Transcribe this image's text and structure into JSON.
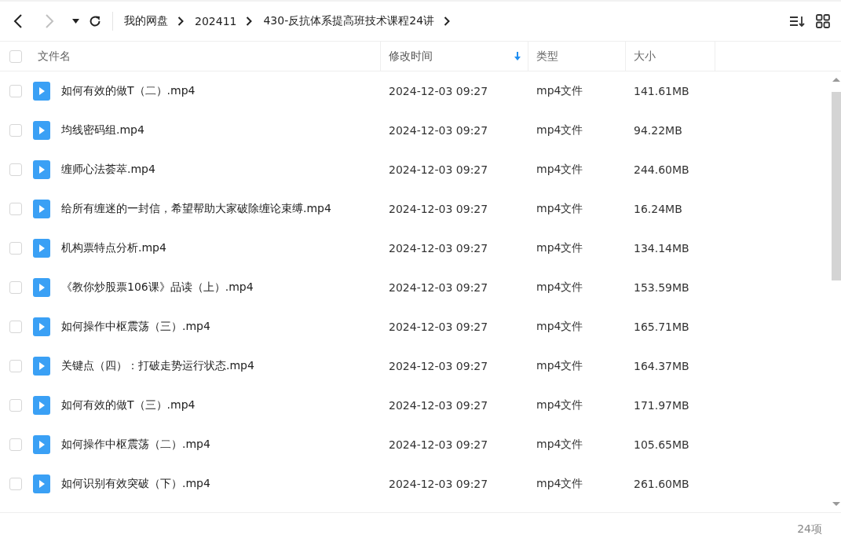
{
  "toolbar": {
    "back": {
      "disabled": false
    },
    "forward": {
      "disabled": true
    },
    "breadcrumbs": [
      "我的网盘",
      "202411",
      "430-反抗体系提高班技术课程24讲"
    ]
  },
  "table": {
    "columns": [
      {
        "label": "文件名",
        "sorted": false
      },
      {
        "label": "修改时间",
        "sorted": true
      },
      {
        "label": "类型",
        "sorted": false
      },
      {
        "label": "大小",
        "sorted": false
      }
    ],
    "all_checked": false,
    "rows": [
      {
        "name": "如何有效的做T（二）.mp4",
        "modified": "2024-12-03 09:27",
        "type": "mp4文件",
        "size": "141.61MB",
        "checked": false
      },
      {
        "name": "均线密码组.mp4",
        "modified": "2024-12-03 09:27",
        "type": "mp4文件",
        "size": "94.22MB",
        "checked": false
      },
      {
        "name": "缠师心法荟萃.mp4",
        "modified": "2024-12-03 09:27",
        "type": "mp4文件",
        "size": "244.60MB",
        "checked": false
      },
      {
        "name": "给所有缠迷的一封信，希望帮助大家破除缠论束缚.mp4",
        "modified": "2024-12-03 09:27",
        "type": "mp4文件",
        "size": "16.24MB",
        "checked": false
      },
      {
        "name": "机构票特点分析.mp4",
        "modified": "2024-12-03 09:27",
        "type": "mp4文件",
        "size": "134.14MB",
        "checked": false
      },
      {
        "name": "《教你炒股票106课》品读（上）.mp4",
        "modified": "2024-12-03 09:27",
        "type": "mp4文件",
        "size": "153.59MB",
        "checked": false
      },
      {
        "name": "如何操作中枢震荡（三）.mp4",
        "modified": "2024-12-03 09:27",
        "type": "mp4文件",
        "size": "165.71MB",
        "checked": false
      },
      {
        "name": "关键点（四）：打破走势运行状态.mp4",
        "modified": "2024-12-03 09:27",
        "type": "mp4文件",
        "size": "164.37MB",
        "checked": false
      },
      {
        "name": "如何有效的做T（三）.mp4",
        "modified": "2024-12-03 09:27",
        "type": "mp4文件",
        "size": "171.97MB",
        "checked": false
      },
      {
        "name": "如何操作中枢震荡（二）.mp4",
        "modified": "2024-12-03 09:27",
        "type": "mp4文件",
        "size": "105.65MB",
        "checked": false
      },
      {
        "name": "如何识别有效突破（下）.mp4",
        "modified": "2024-12-03 09:27",
        "type": "mp4文件",
        "size": "261.60MB",
        "checked": false
      }
    ]
  },
  "status_bar": {
    "count": "24项"
  }
}
